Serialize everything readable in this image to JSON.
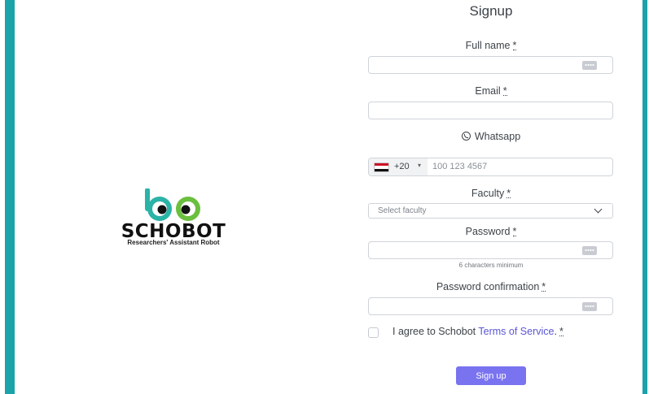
{
  "brand": {
    "name": "SCHOBOT",
    "tagline": "Researchers' Assistant Robot",
    "colors": {
      "accent_bar": "#1aa3a8",
      "logo_teal": "#2bb3a8",
      "logo_green": "#6bbf3f",
      "button": "#7a73f0",
      "link": "#5a55d6"
    }
  },
  "form": {
    "title": "Signup",
    "required_mark": "*",
    "full_name": {
      "label": "Full name",
      "icon": "password-manager-key-icon"
    },
    "email": {
      "label": "Email"
    },
    "whatsapp": {
      "label": "Whatsapp",
      "icon": "whatsapp-icon",
      "country_code": "+20",
      "country_flag": "egypt-flag-icon",
      "placeholder": "100 123 4567"
    },
    "faculty": {
      "label": "Faculty",
      "placeholder": "Select faculty",
      "icon": "chevron-down-icon"
    },
    "password": {
      "label": "Password",
      "hint": "6 characters minimum",
      "icon": "password-manager-key-icon"
    },
    "password_confirmation": {
      "label": "Password confirmation",
      "icon": "password-manager-key-icon"
    },
    "terms": {
      "prefix": "I agree to Schobot ",
      "link": "Terms of Service",
      "suffix": "."
    },
    "submit_label": "Sign up"
  }
}
